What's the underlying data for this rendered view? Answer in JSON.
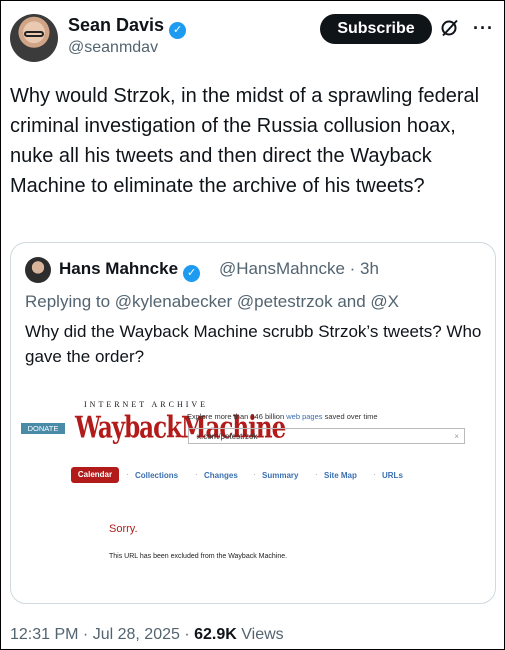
{
  "author": {
    "name": "Sean Davis",
    "handle": "@seanmdav",
    "verified_mark": "✓"
  },
  "actions": {
    "subscribe_label": "Subscribe",
    "grok_icon": "grok-icon",
    "more_icon": "more-icon",
    "more_glyph": "···"
  },
  "tweet": {
    "text": "Why would Strzok, in the midst of a sprawling federal criminal investigation of the Russia collusion hoax, nuke all his tweets and then direct the Wayback Machine to eliminate the archive of his tweets?"
  },
  "quote": {
    "name": "Hans Mahncke",
    "handle_time": "@HansMahncke · 3h",
    "reply_line": "Replying to @kylenabecker @petestrzok and @X",
    "text": "Why did the Wayback Machine scrubb Strzok’s tweets? Who gave the order?",
    "image": {
      "ia_text": "INTERNET ARCHIVE",
      "logo_text": "WaybackMachine",
      "donate": "DONATE",
      "explore_prefix": "Explore more than 946 billion ",
      "explore_link": "web pages",
      "explore_suffix": " saved over time",
      "url_value": "x.com/petestrzok",
      "url_clear": "×",
      "tabs": [
        "Calendar",
        "Collections",
        "Changes",
        "Summary",
        "Site Map",
        "URLs"
      ],
      "separator": "·",
      "sorry": "Sorry.",
      "excluded": "This URL has been excluded from the Wayback Machine."
    }
  },
  "meta": {
    "time_date": "12:31 PM · Jul 28, 2025 · ",
    "views_count": "62.9K",
    "views_label": " Views"
  },
  "colors": {
    "accent": "#1d9bf0",
    "wayback_red": "#b31b1b",
    "link_blue": "#3a6fb0"
  }
}
